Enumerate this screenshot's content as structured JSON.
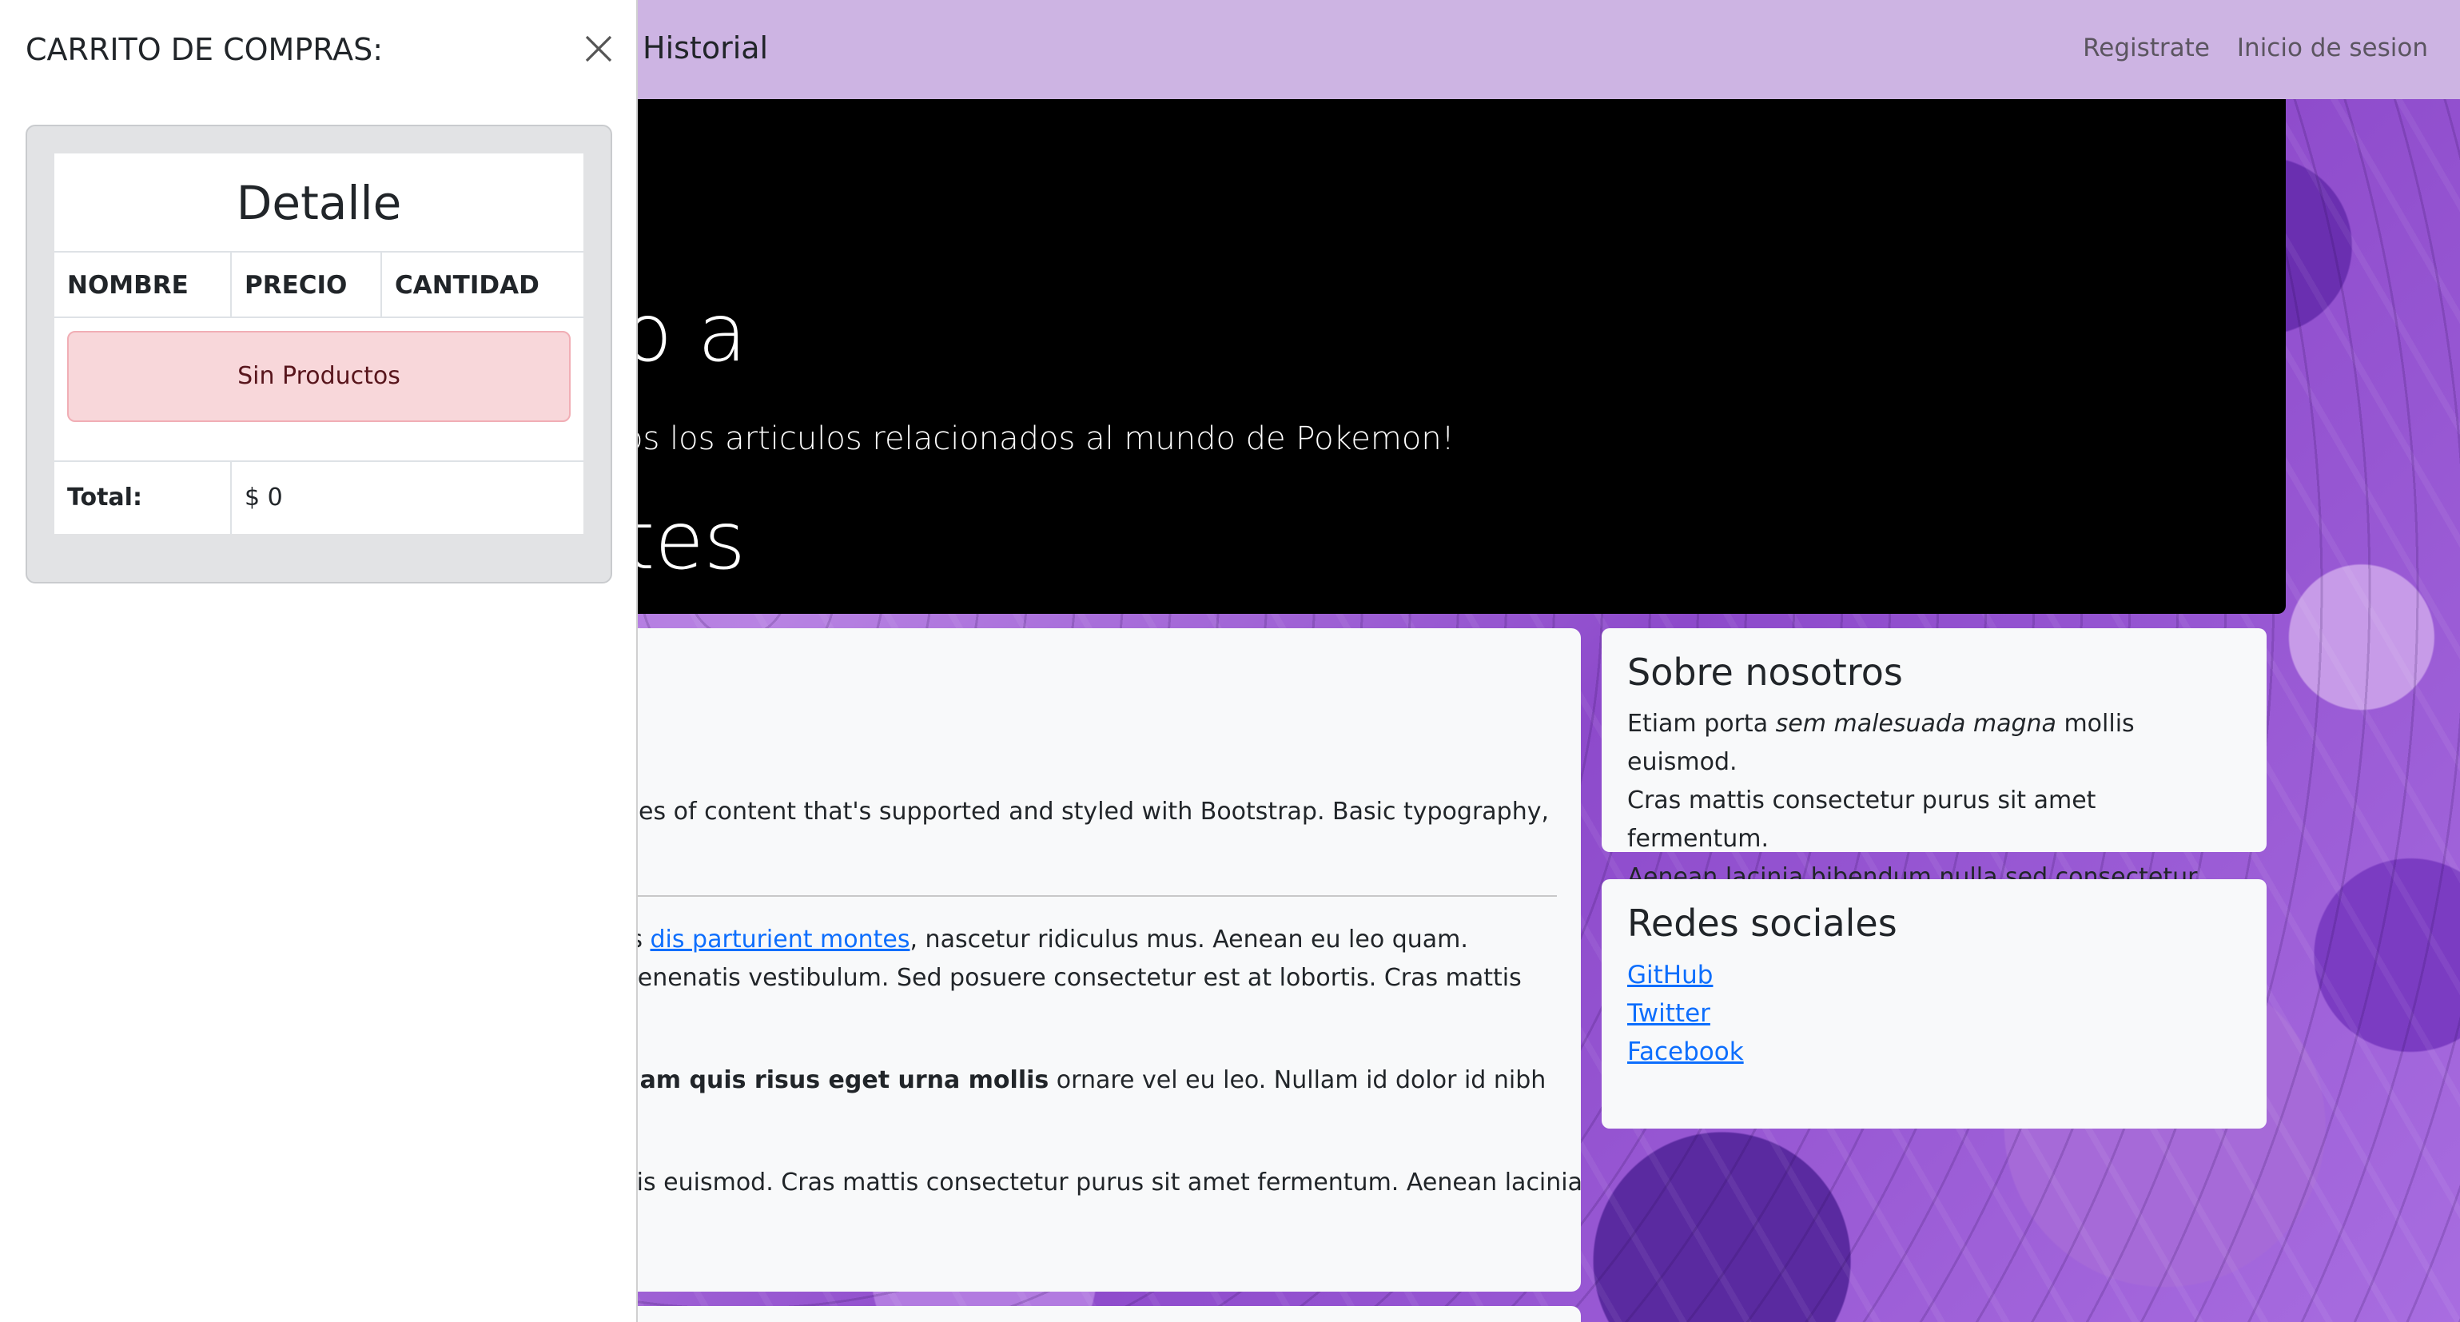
{
  "navbar": {
    "history_link": "Historial",
    "register_link": "Registrate",
    "login_link": "Inicio de sesion"
  },
  "hero": {
    "title_line1": "o a",
    "title_line2": "tes",
    "subtitle": "os los articulos relacionados al mundo de Pokemon!"
  },
  "main": {
    "line1": "pes of content that's supported and styled with Bootstrap. Basic typography,",
    "line2_prefix": "is ",
    "line2_link": "dis parturient montes",
    "line2_suffix": ", nascetur ridiculus mus. Aenean eu leo quam.",
    "line3": "venenatis vestibulum. Sed posuere consectetur est at lobortis. Cras mattis",
    "line4_bold": "llam quis risus eget urna mollis",
    "line4_rest": " ornare vel eu leo. Nullam id dolor id nibh",
    "line5": "llis euismod. Cras mattis consectetur purus sit amet fermentum. Aenean lacinia"
  },
  "about": {
    "title": "Sobre nosotros",
    "text_prefix": "Etiam porta ",
    "text_italic": "sem malesuada magna",
    "text_line1_rest": " mollis euismod.",
    "text_line2": "Cras mattis consectetur purus sit amet fermentum.",
    "text_line3": "Aenean lacinia bibendum nulla sed consectetur."
  },
  "social": {
    "title": "Redes sociales",
    "links": [
      "GitHub",
      "Twitter",
      "Facebook"
    ]
  },
  "cart": {
    "title": "CARRITO DE COMPRAS:",
    "close_icon": "close-icon",
    "table_title": "Detalle",
    "columns": [
      "NOMBRE",
      "PRECIO",
      "CANTIDAD"
    ],
    "empty_message": "Sin Productos",
    "total_label": "Total:",
    "total_value": "$ 0"
  },
  "colors": {
    "navbar": "#cdb4e3",
    "alert_bg": "#f8d7da",
    "link": "#0d6efd"
  }
}
